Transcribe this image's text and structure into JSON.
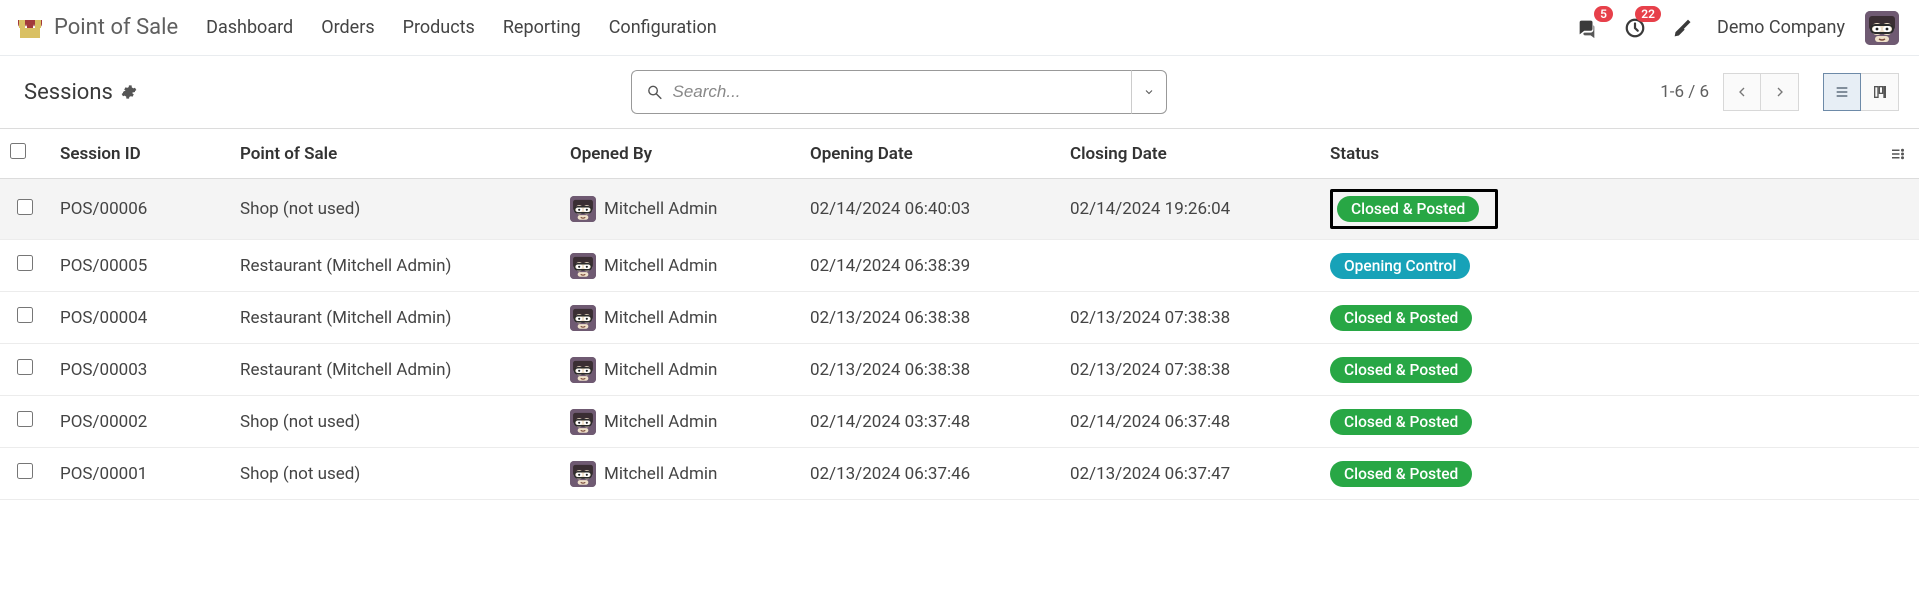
{
  "app": {
    "title": "Point of Sale"
  },
  "nav": {
    "items": [
      {
        "label": "Dashboard"
      },
      {
        "label": "Orders"
      },
      {
        "label": "Products"
      },
      {
        "label": "Reporting"
      },
      {
        "label": "Configuration"
      }
    ]
  },
  "badges": {
    "messages": "5",
    "activities": "22"
  },
  "company": "Demo Company",
  "breadcrumb": "Sessions",
  "search": {
    "placeholder": "Search..."
  },
  "pager": "1-6 / 6",
  "columns": {
    "session_id": "Session ID",
    "point_of_sale": "Point of Sale",
    "opened_by": "Opened By",
    "opening_date": "Opening Date",
    "closing_date": "Closing Date",
    "status": "Status"
  },
  "statuses": {
    "closed_posted": "Closed & Posted",
    "opening_control": "Opening Control"
  },
  "rows": [
    {
      "sid": "POS/00006",
      "pos": "Shop (not used)",
      "user": "Mitchell Admin",
      "open": "02/14/2024 06:40:03",
      "close": "02/14/2024 19:26:04",
      "status_key": "closed_posted",
      "status_color": "green",
      "highlight": true
    },
    {
      "sid": "POS/00005",
      "pos": "Restaurant (Mitchell Admin)",
      "user": "Mitchell Admin",
      "open": "02/14/2024 06:38:39",
      "close": "",
      "status_key": "opening_control",
      "status_color": "blue",
      "highlight": false
    },
    {
      "sid": "POS/00004",
      "pos": "Restaurant (Mitchell Admin)",
      "user": "Mitchell Admin",
      "open": "02/13/2024 06:38:38",
      "close": "02/13/2024 07:38:38",
      "status_key": "closed_posted",
      "status_color": "green",
      "highlight": false
    },
    {
      "sid": "POS/00003",
      "pos": "Restaurant (Mitchell Admin)",
      "user": "Mitchell Admin",
      "open": "02/13/2024 06:38:38",
      "close": "02/13/2024 07:38:38",
      "status_key": "closed_posted",
      "status_color": "green",
      "highlight": false
    },
    {
      "sid": "POS/00002",
      "pos": "Shop (not used)",
      "user": "Mitchell Admin",
      "open": "02/14/2024 03:37:48",
      "close": "02/14/2024 06:37:48",
      "status_key": "closed_posted",
      "status_color": "green",
      "highlight": false
    },
    {
      "sid": "POS/00001",
      "pos": "Shop (not used)",
      "user": "Mitchell Admin",
      "open": "02/13/2024 06:37:46",
      "close": "02/13/2024 06:37:47",
      "status_key": "closed_posted",
      "status_color": "green",
      "highlight": false
    }
  ]
}
